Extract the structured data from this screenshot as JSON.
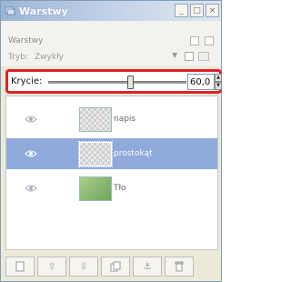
{
  "window": {
    "title": "Warstwy",
    "controls": [
      "_",
      "□",
      "×"
    ]
  },
  "panel": {
    "title": "Warstwy"
  },
  "mode": {
    "label": "Tryb:",
    "value": "Zwykły"
  },
  "opacity": {
    "label": "Krycie:",
    "value": "60,0",
    "level_percent": 60
  },
  "layers": [
    {
      "name": "napis",
      "visible": true,
      "selected": false,
      "thumb": "checker"
    },
    {
      "name": "prostokąt",
      "visible": true,
      "selected": true,
      "thumb": "checker"
    },
    {
      "name": "Tło",
      "visible": true,
      "selected": false,
      "thumb": "green"
    }
  ],
  "toolbar": {
    "buttons": [
      "new-layer-icon",
      "raise-layer-icon",
      "lower-layer-icon",
      "duplicate-layer-icon",
      "anchor-layer-icon",
      "delete-layer-icon"
    ]
  },
  "colors": {
    "selected_row": "#8faadb",
    "highlight_frame": "#e0202b"
  }
}
